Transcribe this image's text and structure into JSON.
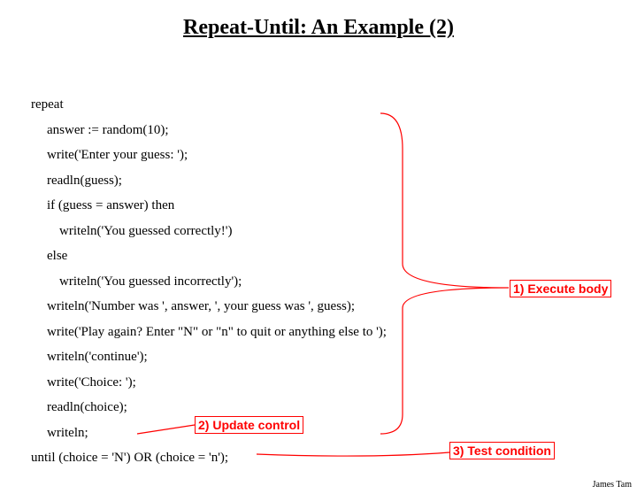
{
  "title": "Repeat-Until: An Example (2)",
  "code": {
    "l0": "repeat",
    "l1": "answer := random(10);",
    "l2": "write('Enter your guess: ');",
    "l3": "readln(guess);",
    "l4": "if (guess = answer) then",
    "l5": "writeln('You guessed correctly!')",
    "l6": "else",
    "l7": "writeln('You guessed incorrectly');",
    "l8": "writeln('Number was ', answer, ', your guess was ', guess);",
    "l9": "write('Play again?  Enter \"N\" or \"n\" to quit or anything else to ');",
    "l10": "writeln('continue');",
    "l11": "write('Choice: ');",
    "l12": "readln(choice);",
    "l13": "writeln;",
    "l14": "until (choice = 'N') OR (choice = 'n');"
  },
  "callouts": {
    "c1": "1) Execute body",
    "c2": "2) Update control",
    "c3": "3) Test condition"
  },
  "footer": "James Tam"
}
